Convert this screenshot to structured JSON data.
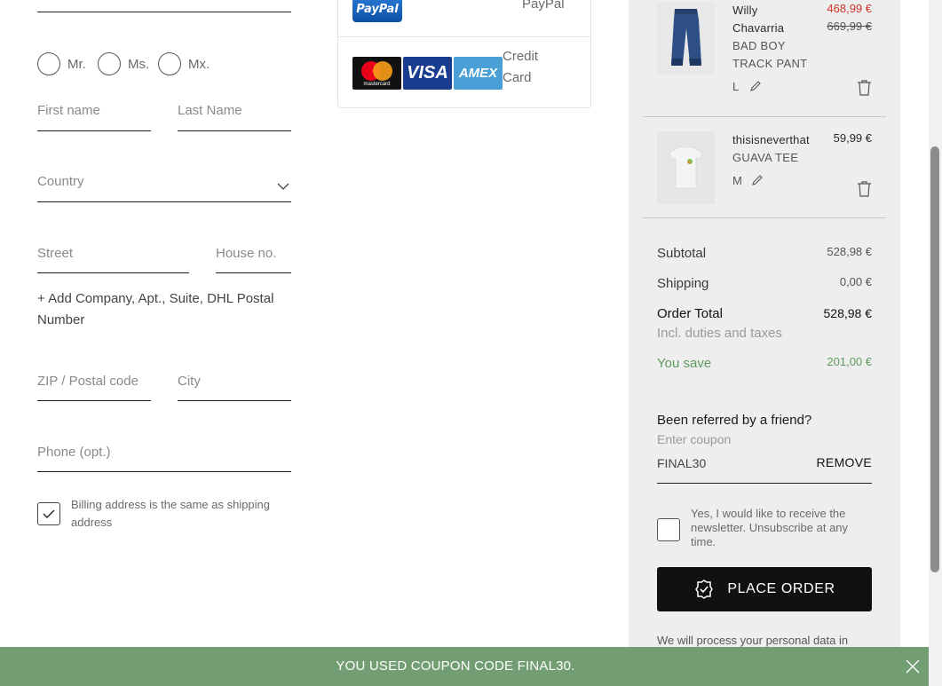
{
  "form": {
    "salutations": [
      {
        "label": "Mr."
      },
      {
        "label": "Ms."
      },
      {
        "label": "Mx."
      }
    ],
    "first_name_placeholder": "First name",
    "last_name_placeholder": "Last Name",
    "country_placeholder": "Country",
    "street_placeholder": "Street",
    "house_no_placeholder": "House no.",
    "add_company_link": "+ Add Company, Apt., Suite, DHL Postal Number",
    "zip_placeholder": "ZIP / Postal code",
    "city_placeholder": "City",
    "phone_placeholder": "Phone (opt.)",
    "billing_same_label": "Billing address is the same as shipping address"
  },
  "payment": {
    "paypal_label": "PayPal",
    "paypal_logo_text": "PayPal",
    "credit_card_label": "Credit Card",
    "card_logos": {
      "mastercard": "mastercard",
      "visa": "VISA",
      "amex": "AMEX"
    }
  },
  "cart": {
    "items": [
      {
        "brand": "Willy Chavarria",
        "name": "BAD BOY TRACK PANT",
        "size": "L",
        "price": "468,99 €",
        "old_price": "669,99 €"
      },
      {
        "brand": "thisisneverthat",
        "name": "GUAVA TEE",
        "size": "M",
        "price": "59,99 €"
      }
    ],
    "subtotal_label": "Subtotal",
    "subtotal_value": "528,98 €",
    "shipping_label": "Shipping",
    "shipping_value": "0,00 €",
    "total_label": "Order Total",
    "total_value": "528,98 €",
    "total_note": "Incl. duties and taxes",
    "save_label": "You save",
    "save_value": "201,00 €",
    "referral_title": "Been referred by a friend?",
    "coupon_placeholder": "Enter coupon",
    "coupon_value": "FINAL30",
    "remove_label": "REMOVE",
    "newsletter_label": "Yes, I would like to receive the newsletter. Unsubscribe at any time.",
    "place_order_label": "PLACE ORDER",
    "privacy_note": "We will process your personal data in"
  },
  "banner": {
    "message": "YOU USED COUPON CODE FINAL30."
  },
  "colors": {
    "sale_red": "#d0342c",
    "save_green": "#5f9a5f",
    "banner_green": "#739d72",
    "button_dark": "#111111"
  }
}
